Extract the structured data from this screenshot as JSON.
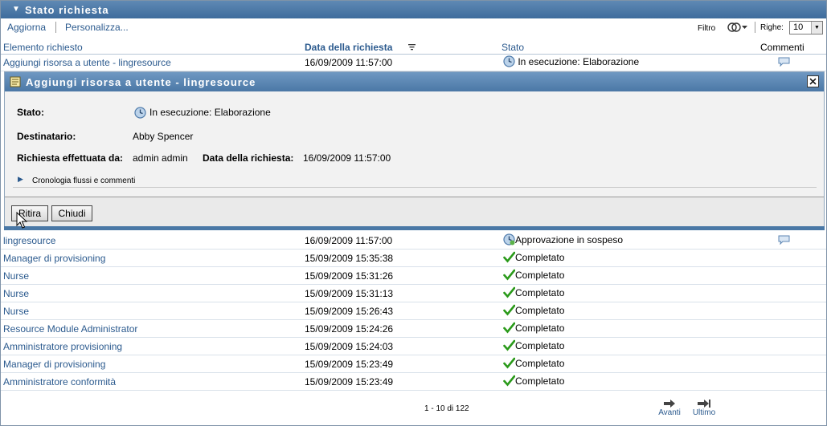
{
  "panel": {
    "title": "Stato richiesta"
  },
  "toolbar": {
    "refresh_label": "Aggiorna",
    "customize_label": "Personalizza...",
    "filter_label": "Filtro",
    "rows_label": "Righe:",
    "rows_value": "10"
  },
  "columns": {
    "item": "Elemento richiesto",
    "date": "Data della richiesta",
    "status": "Stato",
    "comments": "Commenti"
  },
  "first_row": {
    "item": "Aggiungi risorsa a utente - lingresource",
    "date": "16/09/2009 11:57:00",
    "status": "In esecuzione: Elaborazione"
  },
  "detail": {
    "title": "Aggiungi risorsa a utente - lingresource",
    "status_label": "Stato:",
    "status_value": "In esecuzione: Elaborazione",
    "recipient_label": "Destinatario:",
    "recipient_value": "Abby Spencer",
    "requested_by_label": "Richiesta effettuata da:",
    "requested_by_value": "admin admin",
    "request_date_label": "Data della richiesta:",
    "request_date_value": "16/09/2009 11:57:00",
    "history_label": "Cronologia flussi e commenti",
    "withdraw_label": "Ritira",
    "close_label": "Chiudi"
  },
  "rows": [
    {
      "item": "lingresource",
      "date": "16/09/2009 11:57:00",
      "status": "Approvazione in sospeso",
      "icon": "clock-pending-icon",
      "comment": true
    },
    {
      "item": "Manager di provisioning",
      "date": "15/09/2009 15:35:38",
      "status": "Completato",
      "icon": "check-icon",
      "comment": false
    },
    {
      "item": "Nurse",
      "date": "15/09/2009 15:31:26",
      "status": "Completato",
      "icon": "check-icon",
      "comment": false
    },
    {
      "item": "Nurse",
      "date": "15/09/2009 15:31:13",
      "status": "Completato",
      "icon": "check-icon",
      "comment": false
    },
    {
      "item": "Nurse",
      "date": "15/09/2009 15:26:43",
      "status": "Completato",
      "icon": "check-icon",
      "comment": false
    },
    {
      "item": "Resource Module Administrator",
      "date": "15/09/2009 15:24:26",
      "status": "Completato",
      "icon": "check-icon",
      "comment": false
    },
    {
      "item": "Amministratore provisioning",
      "date": "15/09/2009 15:24:03",
      "status": "Completato",
      "icon": "check-icon",
      "comment": false
    },
    {
      "item": "Manager di provisioning",
      "date": "15/09/2009 15:23:49",
      "status": "Completato",
      "icon": "check-icon",
      "comment": false
    },
    {
      "item": "Amministratore conformità",
      "date": "15/09/2009 15:23:49",
      "status": "Completato",
      "icon": "check-icon",
      "comment": false
    }
  ],
  "pager": {
    "summary": "1 - 10 di 122",
    "next_label": "Avanti",
    "last_label": "Ultimo"
  },
  "colors": {
    "header": "#4a78a6",
    "link": "#2b5a8e",
    "check": "#2a9a1a"
  }
}
